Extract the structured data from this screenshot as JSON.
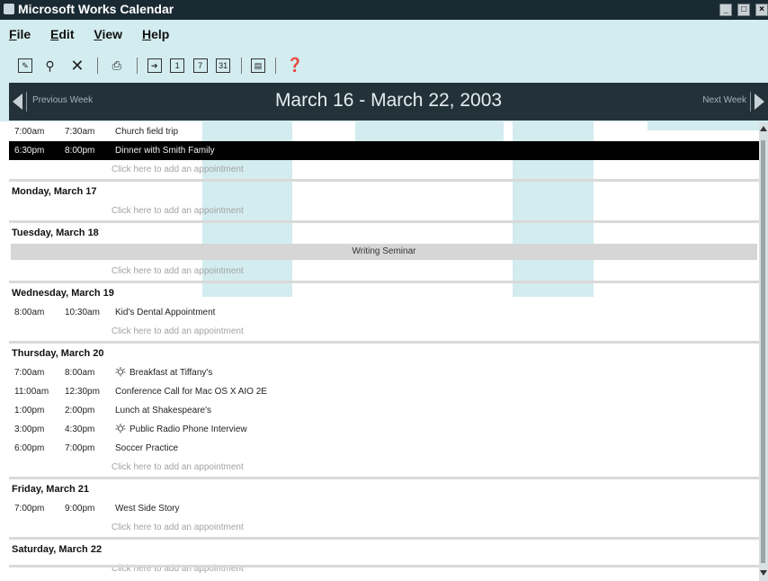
{
  "window": {
    "title": "Microsoft Works Calendar"
  },
  "menu": [
    {
      "label": "File",
      "accel": "F",
      "rest": "ile"
    },
    {
      "label": "Edit",
      "accel": "E",
      "rest": "dit"
    },
    {
      "label": "View",
      "accel": "V",
      "rest": "iew"
    },
    {
      "label": "Help",
      "accel": "H",
      "rest": "elp"
    }
  ],
  "toolbar": {
    "day_view_label": "1",
    "week_view_label": "7",
    "month_view_label": "31"
  },
  "week_header": {
    "previous_label": "Previous Week",
    "title": "March 16 - March 22, 2003",
    "next_label": "Next Week"
  },
  "add_text": "Click here to add an appointment",
  "sunday": {
    "appointments": [
      {
        "start": "7:00am",
        "end": "7:30am",
        "title": "Church field trip"
      },
      {
        "start": "6:30pm",
        "end": "8:00pm",
        "title": "Dinner with Smith Family"
      }
    ]
  },
  "monday": {
    "header": "Monday, March 17"
  },
  "tuesday": {
    "header": "Tuesday, March 18",
    "allday": "Writing Seminar"
  },
  "wednesday": {
    "header": "Wednesday, March 19",
    "appointments": [
      {
        "start": "8:00am",
        "end": "10:30am",
        "title": "Kid's Dental Appointment"
      }
    ]
  },
  "thursday": {
    "header": "Thursday, March 20",
    "appointments": [
      {
        "start": "7:00am",
        "end": "8:00am",
        "title": "Breakfast at Tiffany's"
      },
      {
        "start": "11:00am",
        "end": "12:30pm",
        "title": "Conference Call for Mac OS X AIO 2E"
      },
      {
        "start": "1:00pm",
        "end": "2:00pm",
        "title": "Lunch at Shakespeare's"
      },
      {
        "start": "3:00pm",
        "end": "4:30pm",
        "title": "Public Radio Phone Interview"
      },
      {
        "start": "6:00pm",
        "end": "7:00pm",
        "title": "Soccer Practice"
      }
    ]
  },
  "friday": {
    "header": "Friday, March 21",
    "appointments": [
      {
        "start": "7:00pm",
        "end": "9:00pm",
        "title": "West Side Story"
      }
    ]
  },
  "saturday": {
    "header": "Saturday, March 22"
  },
  "colors": {
    "title_bar": "#1a2a33",
    "week_header": "#233239",
    "selected_row": "#000000",
    "watermark": "#d3ecef",
    "allday_bar": "#d6d6d6"
  }
}
